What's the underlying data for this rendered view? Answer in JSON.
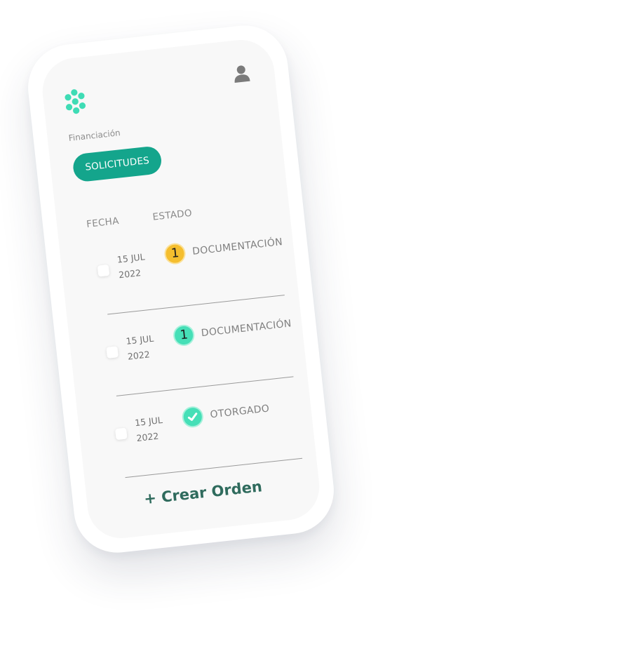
{
  "header": {
    "logo_icon": "flower-dots-logo-icon",
    "user_icon": "person-icon"
  },
  "section": {
    "label": "Financiación",
    "pill_label": "SOLICITUDES"
  },
  "table": {
    "columns": [
      "FECHA",
      "ESTADO"
    ],
    "rows": [
      {
        "date_day": "15 JUL",
        "date_year": "2022",
        "badge": "1",
        "badge_color": "#f5be2e",
        "status": "DOCUMENTACIÓN"
      },
      {
        "date_day": "15 JUL",
        "date_year": "2022",
        "badge": "1",
        "badge_color": "#46dfb7",
        "status": "DOCUMENTACIÓN"
      },
      {
        "date_day": "15 JUL",
        "date_year": "2022",
        "badge": "check-icon",
        "badge_color": "#46dfb7",
        "status": "OTORGADO"
      }
    ]
  },
  "footer": {
    "cta_label": "+ Crear Orden"
  },
  "colors": {
    "accent": "#14a58c",
    "cta_text": "#2f6b5d",
    "logo": "#3fdcb5"
  }
}
